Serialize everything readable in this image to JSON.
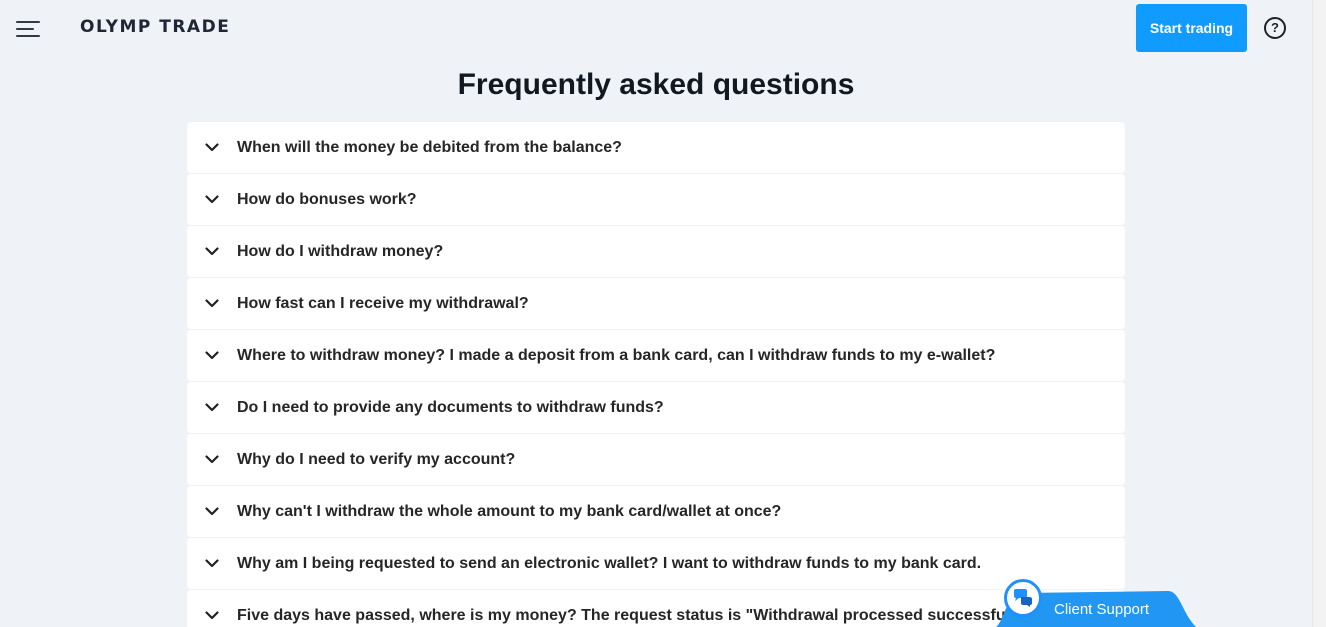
{
  "header": {
    "logo_text": "OLYMP TRADE",
    "start_trading_label": "Start trading",
    "help_symbol": "?"
  },
  "page_title": "Frequently asked questions",
  "faq": [
    {
      "question": "When will the money be debited from the balance?"
    },
    {
      "question": "How do bonuses work?"
    },
    {
      "question": "How do I withdraw money?"
    },
    {
      "question": "How fast can I receive my withdrawal?"
    },
    {
      "question": "Where to withdraw money? I made a deposit from a bank card, can I withdraw funds to my e-wallet?"
    },
    {
      "question": "Do I need to provide any documents to withdraw funds?"
    },
    {
      "question": "Why do I need to verify my account?"
    },
    {
      "question": "Why can't I withdraw the whole amount to my bank card/wallet at once?"
    },
    {
      "question": "Why am I being requested to send an electronic wallet? I want to withdraw funds to my bank card."
    },
    {
      "question": "Five days have passed, where is my money? The request status is \"Withdrawal processed successfully\", wh"
    }
  ],
  "support": {
    "label": "Client Support"
  },
  "icons": {
    "menu": "hamburger-icon",
    "help": "help-circle-icon",
    "chevron": "chevron-down-icon",
    "chat": "chat-bubbles-icon"
  },
  "colors": {
    "background": "#eff2f7",
    "accent": "#0f9bff",
    "support": "#2196f3",
    "logo_green": "#22b36b"
  }
}
